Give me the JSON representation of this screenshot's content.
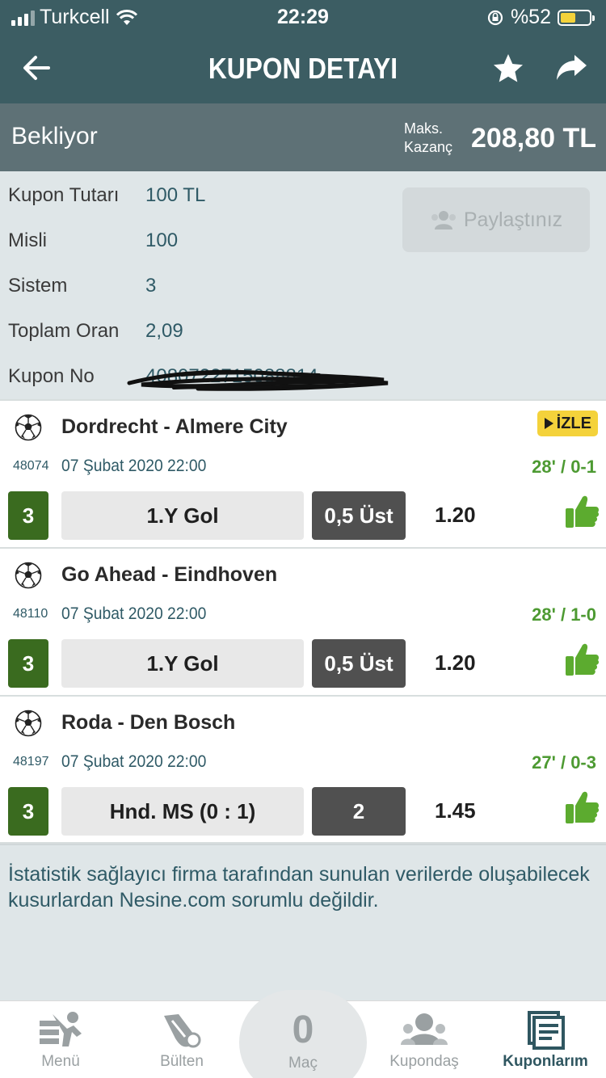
{
  "status_bar": {
    "carrier": "Turkcell",
    "time": "22:29",
    "battery": "%52",
    "battery_level": 0.52
  },
  "header": {
    "title": "KUPON DETAYI",
    "back_icon": "arrow-left-icon",
    "favorite_icon": "star-icon",
    "share_icon": "share-arrow-icon"
  },
  "coupon_status": {
    "state": "Bekliyor",
    "max_win_label_1": "Maks.",
    "max_win_label_2": "Kazanç",
    "max_win_value": "208,80 TL"
  },
  "info": {
    "rows": [
      {
        "label": "Kupon Tutarı",
        "value": "100 TL"
      },
      {
        "label": "Misli",
        "value": "100"
      },
      {
        "label": "Sistem",
        "value": "3"
      },
      {
        "label": "Toplam Oran",
        "value": "2,09"
      },
      {
        "label": "Kupon No",
        "value": "4080722715088814"
      }
    ],
    "share_button": "Paylaştınız"
  },
  "matches": [
    {
      "teams": "Dordrecht - Almere City",
      "watch": "İZLE",
      "code": "48074",
      "date": "07 Şubat 2020 22:00",
      "live": "28' / 0-1",
      "mbs": "3",
      "market": "1.Y Gol",
      "pick": "0,5 Üst",
      "odd": "1.20"
    },
    {
      "teams": "Go Ahead - Eindhoven",
      "code": "48110",
      "date": "07 Şubat 2020 22:00",
      "live": "28' / 1-0",
      "mbs": "3",
      "market": "1.Y Gol",
      "pick": "0,5 Üst",
      "odd": "1.20"
    },
    {
      "teams": "Roda - Den Bosch",
      "code": "48197",
      "date": "07 Şubat 2020 22:00",
      "live": "27' / 0-3",
      "mbs": "3",
      "market": "Hnd. MS (0 : 1)",
      "pick": "2",
      "odd": "1.45"
    }
  ],
  "disclaimer": "İstatistik sağlayıcı firma tarafından sunulan verilerde oluşabilecek kusurlardan Nesine.com sorumlu değildir.",
  "tabs": [
    {
      "label": "Menü",
      "icon": "menu-icon"
    },
    {
      "label": "Bülten",
      "icon": "bulletin-icon"
    },
    {
      "label": "Maç",
      "count": "0"
    },
    {
      "label": "Kupondaş",
      "icon": "community-icon"
    },
    {
      "label": "Kuponlarım",
      "icon": "my-coupons-icon",
      "active": true
    }
  ],
  "colors": {
    "header": "#3c5d63",
    "status_row": "#5e7176",
    "panel": "#dfe6e8",
    "accent_text": "#2f5a66",
    "live_green": "#4d9a32",
    "mbs_green": "#3a6b1f",
    "watch_yellow": "#f4d23b"
  }
}
